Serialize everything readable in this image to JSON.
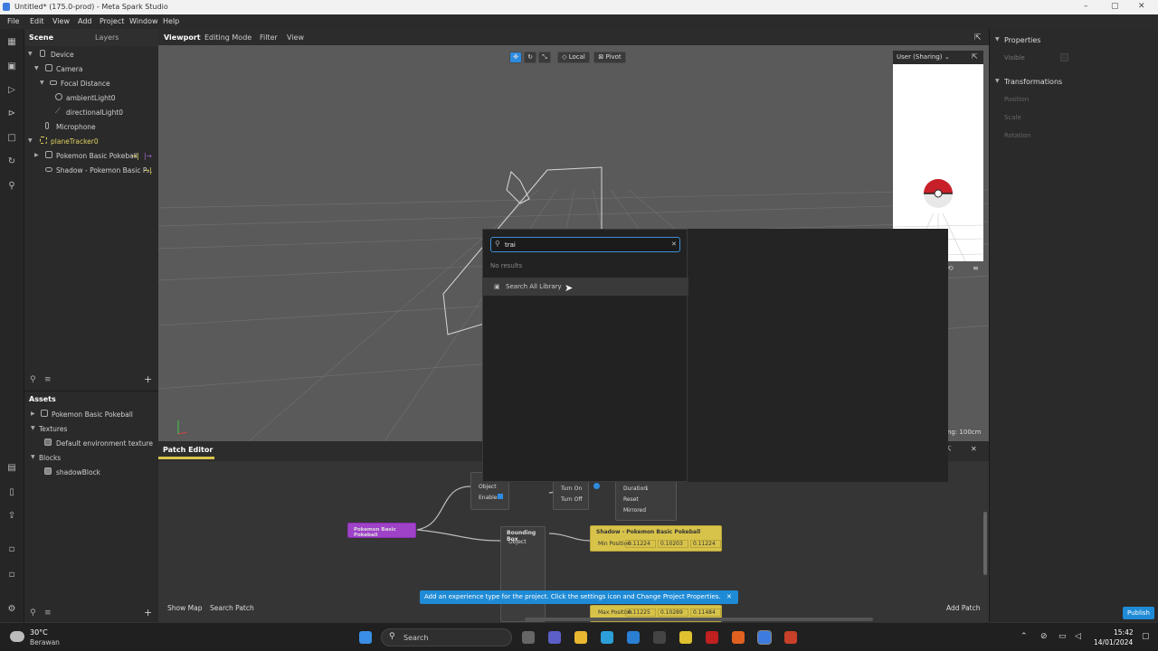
{
  "titlebar": {
    "title": "Untitled* (175.0-prod) - Meta Spark Studio",
    "minimize": "–",
    "maximize": "▢",
    "close": "✕"
  },
  "menu": [
    "File",
    "Edit",
    "View",
    "Add",
    "Project",
    "Window",
    "Help"
  ],
  "scene": {
    "tabs": [
      "Scene",
      "Layers"
    ],
    "tree": [
      {
        "label": "Device"
      },
      {
        "label": "Camera"
      },
      {
        "label": "Focal Distance"
      },
      {
        "label": "ambientLight0"
      },
      {
        "label": "directionalLight0"
      },
      {
        "label": "Microphone"
      },
      {
        "label": "planeTracker0"
      },
      {
        "label": "Pokemon Basic Pokeball"
      },
      {
        "label": "Shadow - Pokemon Basic P..."
      }
    ]
  },
  "assets": {
    "header": "Assets",
    "items": [
      {
        "label": "Pokemon Basic Pokeball"
      },
      {
        "label": "Textures"
      },
      {
        "label": "Default environment texture"
      },
      {
        "label": "Blocks"
      },
      {
        "label": "shadowBlock"
      }
    ]
  },
  "viewport": {
    "tabs": [
      "Viewport",
      "Editing Mode",
      "Filter",
      "View"
    ],
    "local_label": "Local",
    "pivot_label": "Pivot",
    "preview_label": "User (Sharing)",
    "grid_label": "ing: 100cm"
  },
  "properties": {
    "header": "Properties",
    "visible_label": "Visible",
    "transformations_header": "Transformations",
    "fields": [
      "Position",
      "Scale",
      "Rotation"
    ]
  },
  "patch_editor": {
    "title": "Patch Editor",
    "show_map": "Show Map",
    "search_patch": "Search Patch",
    "add_patch": "Add Patch",
    "nodes": {
      "pokeball": "Pokemon Basic Pokeball",
      "bounding_box": "Bounding Box",
      "object": "Object",
      "enabled": "Enabled",
      "turn_on": "Turn On",
      "turn_off": "Turn Off",
      "duration": "Duration",
      "duration_val": "1",
      "reset": "Reset",
      "mirrored": "Mirrored",
      "shadow": "Shadow - Pokemon Basic Pokeball",
      "min_position": "Min Position",
      "max_position": "Max Position",
      "v1": "0.11224",
      "v2": "0.10203",
      "v3": "0.11224",
      "v4": "0.11225",
      "v5": "0.10289",
      "v6": "0.11484"
    }
  },
  "search_popup": {
    "query": "trai",
    "no_results": "No results",
    "library_label": "Search All Library"
  },
  "toast": {
    "text": "Add an experience type for the project. Click the settings icon and Change Project Properties."
  },
  "publish_label": "Publish",
  "taskbar": {
    "weather_temp": "30°C",
    "weather_desc": "Berawan",
    "search_placeholder": "Search",
    "time": "15:42",
    "date": "14/01/2024"
  }
}
